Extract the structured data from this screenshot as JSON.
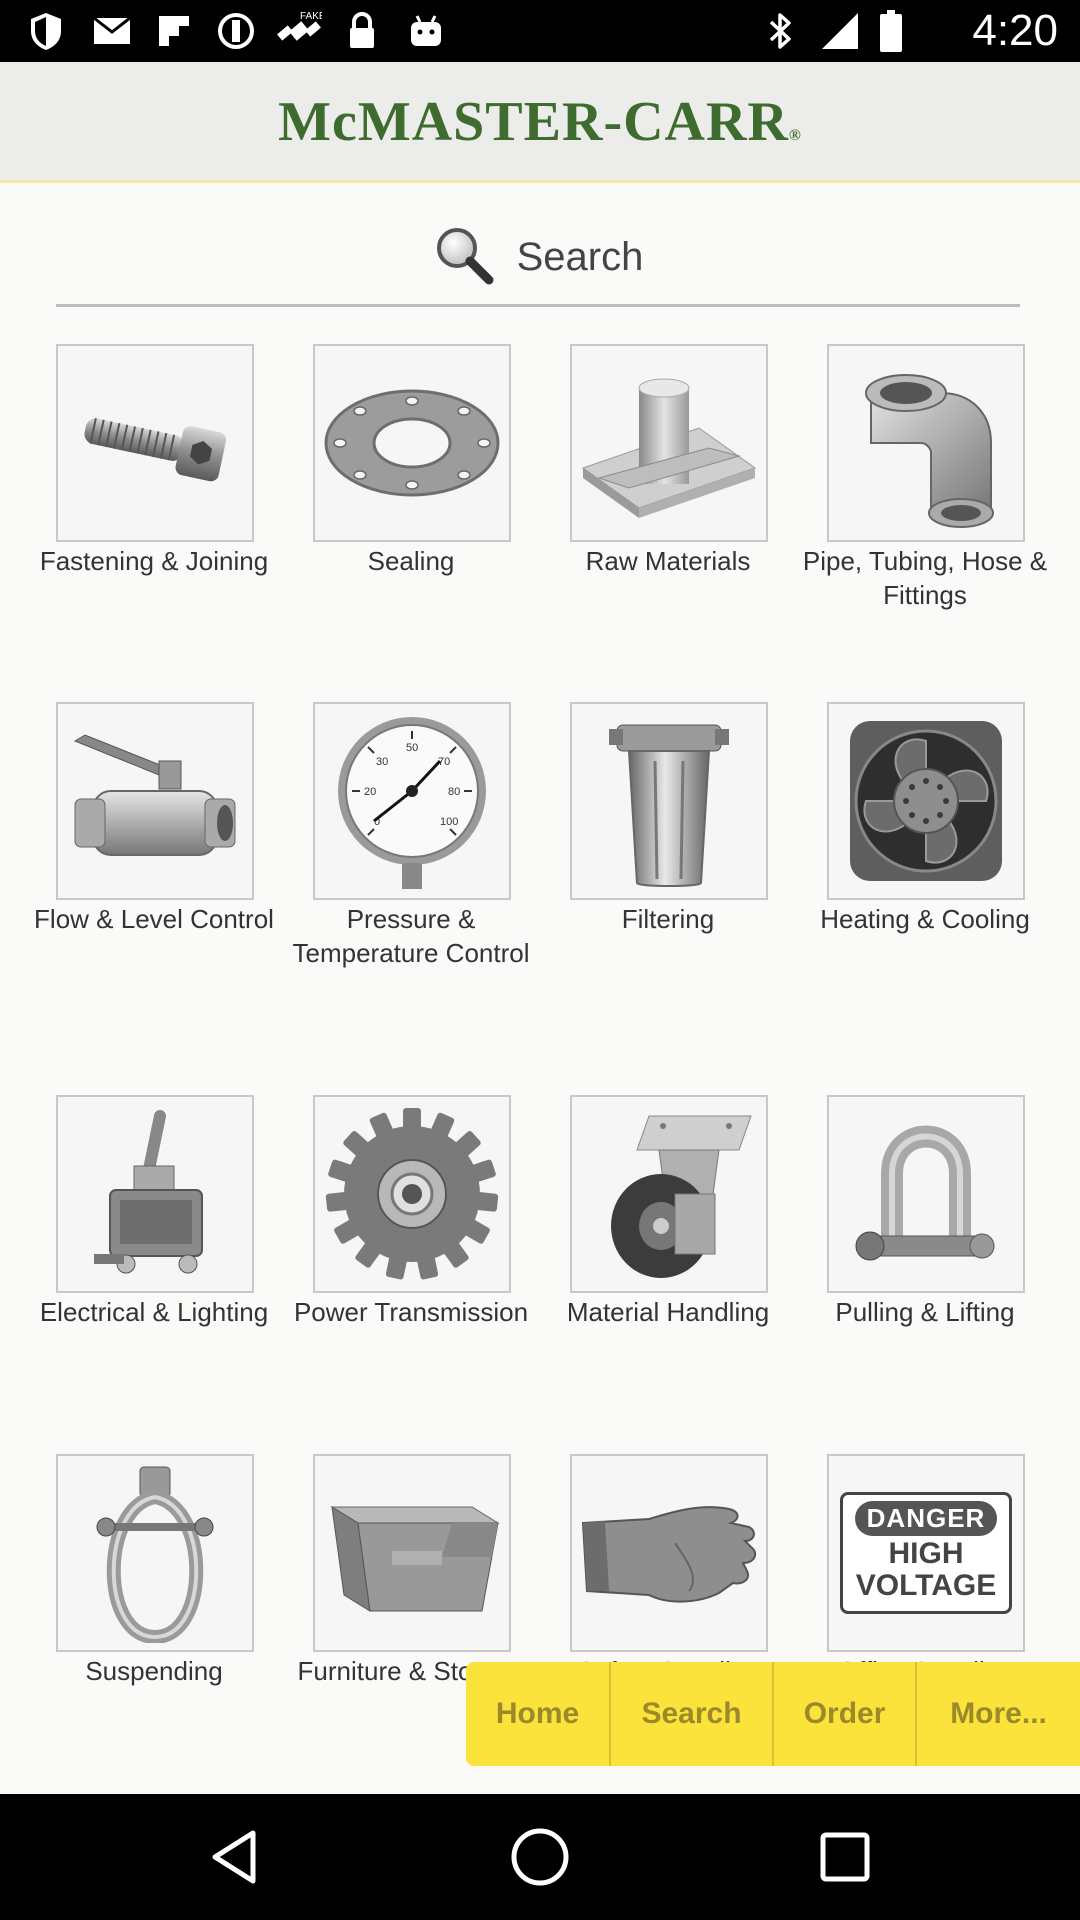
{
  "status_bar": {
    "time": "4:20",
    "icons": [
      "shield-icon",
      "gmail-icon",
      "flipboard-icon",
      "circle-icon",
      "fake-gps-icon",
      "lock-icon",
      "android-icon",
      "bluetooth-icon",
      "signal-icon",
      "battery-icon"
    ]
  },
  "header": {
    "logo": "McMASTER-CARR",
    "logo_mark": "®"
  },
  "search": {
    "label": "Search"
  },
  "categories": [
    {
      "label": "Fastening & Joining",
      "icon": "bolt-icon"
    },
    {
      "label": "Sealing",
      "icon": "gasket-icon"
    },
    {
      "label": "Raw Materials",
      "icon": "raw-materials-icon"
    },
    {
      "label": "Pipe, Tubing, Hose & Fittings",
      "icon": "pipe-elbow-icon"
    },
    {
      "label": "Flow & Level Control",
      "icon": "ball-valve-icon"
    },
    {
      "label": "Pressure & Temperature Control",
      "icon": "pressure-gauge-icon"
    },
    {
      "label": "Filtering",
      "icon": "filter-housing-icon"
    },
    {
      "label": "Heating & Cooling",
      "icon": "fan-icon"
    },
    {
      "label": "Electrical & Lighting",
      "icon": "toggle-switch-icon"
    },
    {
      "label": "Power Transmission",
      "icon": "sprocket-icon"
    },
    {
      "label": "Material Handling",
      "icon": "caster-wheel-icon"
    },
    {
      "label": "Pulling & Lifting",
      "icon": "shackle-icon"
    },
    {
      "label": "Suspending",
      "icon": "pipe-hanger-icon"
    },
    {
      "label": "Furniture & Storage",
      "icon": "storage-bin-icon"
    },
    {
      "label": "Safety Supplies",
      "icon": "glove-icon"
    },
    {
      "label": "Office Supplies",
      "icon": "danger-sign-icon",
      "sign_top": "DANGER",
      "sign_line1": "HIGH",
      "sign_line2": "VOLTAGE"
    }
  ],
  "tabbar": {
    "home": "Home",
    "search": "Search",
    "order": "Order",
    "more": "More..."
  },
  "colors": {
    "brand_green": "#3e6b2e",
    "tab_yellow": "#fbe33b",
    "tab_text": "#9a8a2a"
  }
}
